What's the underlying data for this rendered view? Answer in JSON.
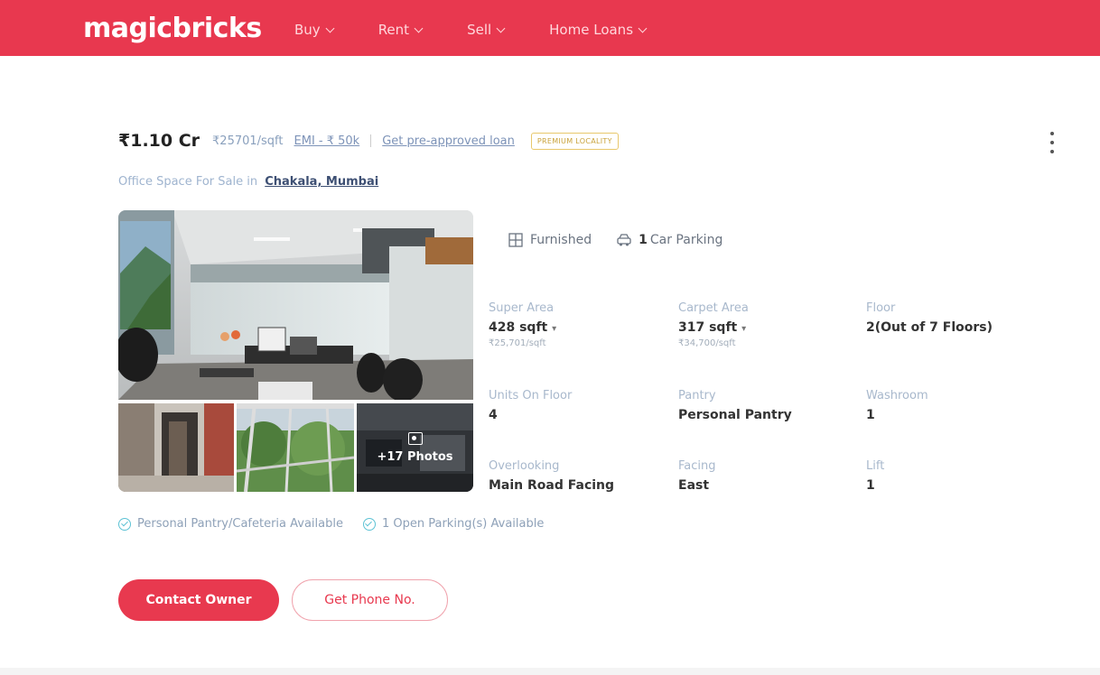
{
  "header": {
    "logo": "magicbricks",
    "nav": [
      {
        "label": "Buy"
      },
      {
        "label": "Rent"
      },
      {
        "label": "Sell"
      },
      {
        "label": "Home Loans"
      }
    ],
    "brand_color": "#e8384f"
  },
  "listing": {
    "price": "₹1.10 Cr",
    "price_per_sqft": "₹25701/sqft",
    "emi": "EMI - ₹ 50k",
    "loan_link": "Get pre-approved loan",
    "badge": "PREMIUM LOCALITY",
    "subtitle_prefix": "Office Space For Sale in",
    "location": "Chakala, Mumbai",
    "more_photos": "+17 Photos",
    "features": {
      "furnished": "Furnished",
      "parking_count": "1",
      "parking_label": "Car Parking"
    },
    "details": {
      "super_area": {
        "label": "Super Area",
        "value": "428 sqft",
        "sub": "₹25,701/sqft"
      },
      "carpet_area": {
        "label": "Carpet Area",
        "value": "317 sqft",
        "sub": "₹34,700/sqft"
      },
      "floor": {
        "label": "Floor",
        "value": "2(Out of 7 Floors)"
      },
      "units_on_floor": {
        "label": "Units On Floor",
        "value": "4"
      },
      "pantry": {
        "label": "Pantry",
        "value": "Personal Pantry"
      },
      "washroom": {
        "label": "Washroom",
        "value": "1"
      },
      "overlooking": {
        "label": "Overlooking",
        "value": "Main Road Facing"
      },
      "facing": {
        "label": "Facing",
        "value": "East"
      },
      "lift": {
        "label": "Lift",
        "value": "1"
      }
    },
    "amenities": [
      "Personal Pantry/Cafeteria Available",
      "1 Open Parking(s) Available"
    ],
    "buttons": {
      "contact": "Contact Owner",
      "phone": "Get Phone No."
    }
  }
}
